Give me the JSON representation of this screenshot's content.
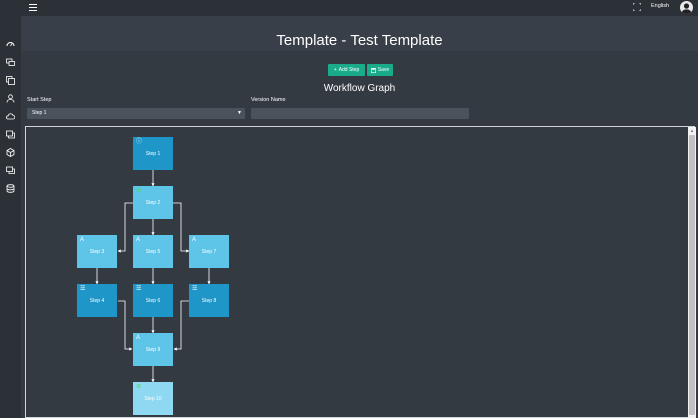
{
  "topbar": {
    "language": "English"
  },
  "header": {
    "title": "Template - Test Template"
  },
  "toolbar": {
    "add_step_label": "Add Step",
    "save_label": "Save"
  },
  "graph": {
    "title": "Workflow Graph"
  },
  "form": {
    "start_step_label": "Start Step",
    "start_step_value": "Step 1",
    "version_name_label": "Version Name",
    "version_name_value": ""
  },
  "sidebar": {
    "icons": [
      "dashboard-icon",
      "monitors-icon",
      "copy-icon",
      "user-icon",
      "cloud-icon",
      "windows-icon",
      "package-icon",
      "chat-icon",
      "database-icon"
    ]
  },
  "nodes": [
    {
      "label": "Step 1",
      "icon": "info-icon",
      "color": "dark"
    },
    {
      "label": "Step 2",
      "icon": "gear-icon",
      "color": "mid"
    },
    {
      "label": "Step 3",
      "icon": "font-a-icon",
      "color": "mid"
    },
    {
      "label": "Step 5",
      "icon": "font-a-icon",
      "color": "mid"
    },
    {
      "label": "Step 7",
      "icon": "font-a-icon",
      "color": "mid"
    },
    {
      "label": "Step 4",
      "icon": "list-icon",
      "color": "dark"
    },
    {
      "label": "Step 6",
      "icon": "list-icon",
      "color": "dark"
    },
    {
      "label": "Step 8",
      "icon": "list-icon",
      "color": "dark"
    },
    {
      "label": "Step 9",
      "icon": "font-a-icon",
      "color": "mid"
    },
    {
      "label": "Step 10",
      "icon": "gear-icon",
      "color": "light"
    }
  ],
  "colors": {
    "background": "#343a42",
    "accent": "#1aab8a",
    "node_dark": "#1e96c8",
    "node_mid": "#5ec4e8",
    "node_light": "#8fd8f2"
  }
}
